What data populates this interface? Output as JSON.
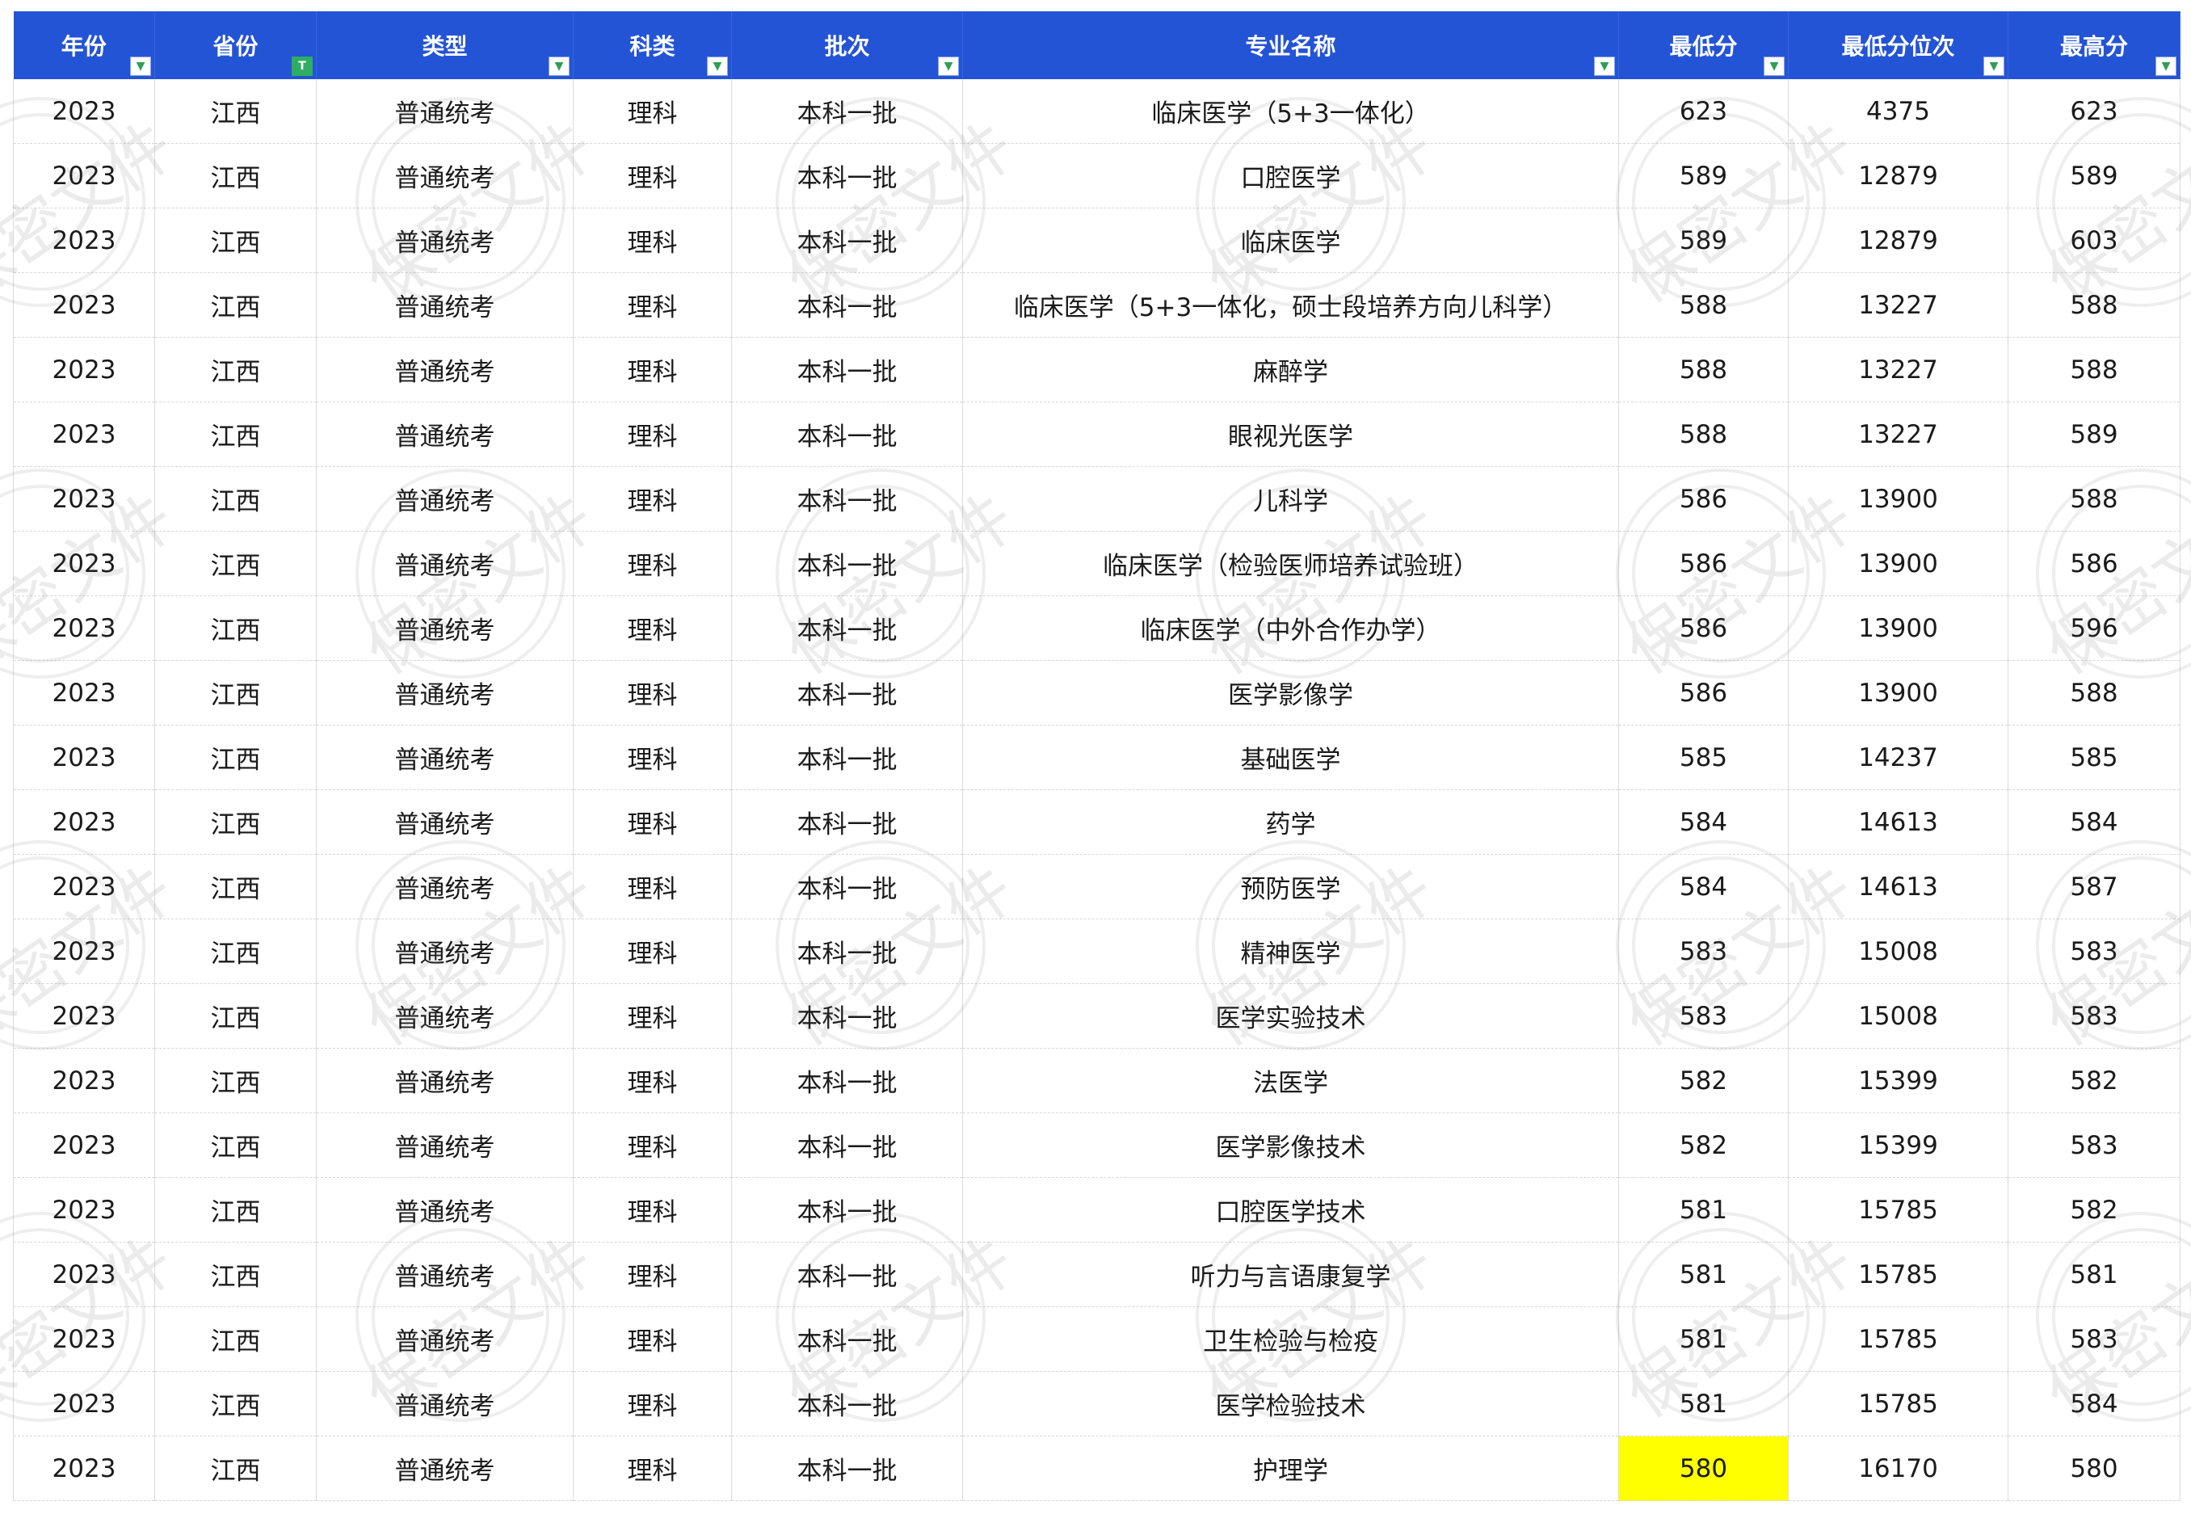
{
  "columns": [
    {
      "label": "年份",
      "filter": "normal"
    },
    {
      "label": "省份",
      "filter": "active"
    },
    {
      "label": "类型",
      "filter": "normal"
    },
    {
      "label": "科类",
      "filter": "normal"
    },
    {
      "label": "批次",
      "filter": "normal"
    },
    {
      "label": "专业名称",
      "filter": "normal"
    },
    {
      "label": "最低分",
      "filter": "normal"
    },
    {
      "label": "最低分位次",
      "filter": "normal"
    },
    {
      "label": "最高分",
      "filter": "normal"
    }
  ],
  "filter_glyphs": {
    "normal": "▼",
    "active": "T"
  },
  "watermark": "保密文件",
  "highlight_color": "#ffff00",
  "rows": [
    [
      "2023",
      "江西",
      "普通统考",
      "理科",
      "本科一批",
      "临床医学（5+3一体化）",
      "623",
      "4375",
      "623"
    ],
    [
      "2023",
      "江西",
      "普通统考",
      "理科",
      "本科一批",
      "口腔医学",
      "589",
      "12879",
      "589"
    ],
    [
      "2023",
      "江西",
      "普通统考",
      "理科",
      "本科一批",
      "临床医学",
      "589",
      "12879",
      "603"
    ],
    [
      "2023",
      "江西",
      "普通统考",
      "理科",
      "本科一批",
      "临床医学（5+3一体化，硕士段培养方向儿科学）",
      "588",
      "13227",
      "588"
    ],
    [
      "2023",
      "江西",
      "普通统考",
      "理科",
      "本科一批",
      "麻醉学",
      "588",
      "13227",
      "588"
    ],
    [
      "2023",
      "江西",
      "普通统考",
      "理科",
      "本科一批",
      "眼视光医学",
      "588",
      "13227",
      "589"
    ],
    [
      "2023",
      "江西",
      "普通统考",
      "理科",
      "本科一批",
      "儿科学",
      "586",
      "13900",
      "588"
    ],
    [
      "2023",
      "江西",
      "普通统考",
      "理科",
      "本科一批",
      "临床医学（检验医师培养试验班）",
      "586",
      "13900",
      "586"
    ],
    [
      "2023",
      "江西",
      "普通统考",
      "理科",
      "本科一批",
      "临床医学（中外合作办学）",
      "586",
      "13900",
      "596"
    ],
    [
      "2023",
      "江西",
      "普通统考",
      "理科",
      "本科一批",
      "医学影像学",
      "586",
      "13900",
      "588"
    ],
    [
      "2023",
      "江西",
      "普通统考",
      "理科",
      "本科一批",
      "基础医学",
      "585",
      "14237",
      "585"
    ],
    [
      "2023",
      "江西",
      "普通统考",
      "理科",
      "本科一批",
      "药学",
      "584",
      "14613",
      "584"
    ],
    [
      "2023",
      "江西",
      "普通统考",
      "理科",
      "本科一批",
      "预防医学",
      "584",
      "14613",
      "587"
    ],
    [
      "2023",
      "江西",
      "普通统考",
      "理科",
      "本科一批",
      "精神医学",
      "583",
      "15008",
      "583"
    ],
    [
      "2023",
      "江西",
      "普通统考",
      "理科",
      "本科一批",
      "医学实验技术",
      "583",
      "15008",
      "583"
    ],
    [
      "2023",
      "江西",
      "普通统考",
      "理科",
      "本科一批",
      "法医学",
      "582",
      "15399",
      "582"
    ],
    [
      "2023",
      "江西",
      "普通统考",
      "理科",
      "本科一批",
      "医学影像技术",
      "582",
      "15399",
      "583"
    ],
    [
      "2023",
      "江西",
      "普通统考",
      "理科",
      "本科一批",
      "口腔医学技术",
      "581",
      "15785",
      "582"
    ],
    [
      "2023",
      "江西",
      "普通统考",
      "理科",
      "本科一批",
      "听力与言语康复学",
      "581",
      "15785",
      "581"
    ],
    [
      "2023",
      "江西",
      "普通统考",
      "理科",
      "本科一批",
      "卫生检验与检疫",
      "581",
      "15785",
      "583"
    ],
    [
      "2023",
      "江西",
      "普通统考",
      "理科",
      "本科一批",
      "医学检验技术",
      "581",
      "15785",
      "584"
    ],
    [
      "2023",
      "江西",
      "普通统考",
      "理科",
      "本科一批",
      "护理学",
      "580",
      "16170",
      "580"
    ]
  ],
  "highlighted_cell": {
    "row": 21,
    "col": 6
  }
}
